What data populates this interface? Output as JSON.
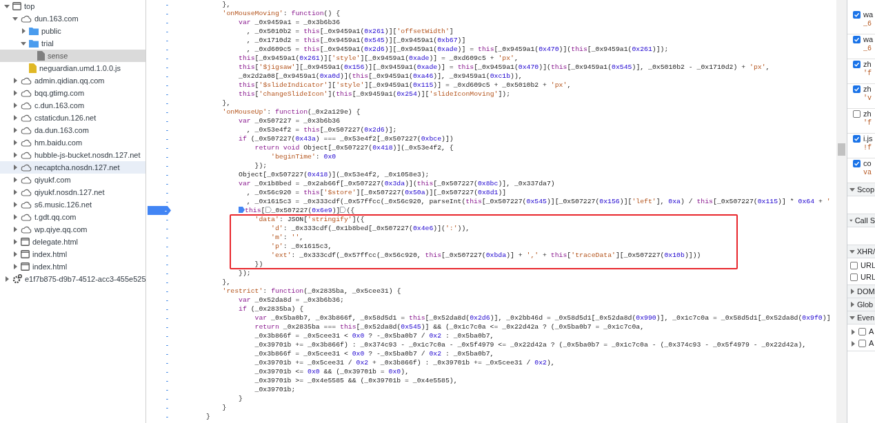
{
  "file_tree": [
    {
      "kind": "frame",
      "label": "top",
      "expanded": true,
      "selected": false,
      "hovered": false,
      "children": [
        {
          "kind": "domain",
          "label": "dun.163.com",
          "expanded": true,
          "selected": false,
          "hovered": false,
          "children": [
            {
              "kind": "folder",
              "label": "public",
              "expanded": false,
              "selected": false,
              "hovered": false
            },
            {
              "kind": "folder",
              "label": "trial",
              "expanded": true,
              "selected": false,
              "hovered": false,
              "children": [
                {
                  "kind": "file",
                  "label": "sense",
                  "selected": true,
                  "hovered": false
                }
              ]
            },
            {
              "kind": "script",
              "label": "neguardian.umd.1.0.0.js",
              "selected": false,
              "hovered": false
            }
          ]
        },
        {
          "kind": "domain",
          "label": "admin.qidian.qq.com",
          "expanded": false,
          "selected": false,
          "hovered": false
        },
        {
          "kind": "domain",
          "label": "bqq.gtimg.com",
          "expanded": false,
          "selected": false,
          "hovered": false
        },
        {
          "kind": "domain",
          "label": "c.dun.163.com",
          "expanded": false,
          "selected": false,
          "hovered": false
        },
        {
          "kind": "domain",
          "label": "cstaticdun.126.net",
          "expanded": false,
          "selected": false,
          "hovered": false
        },
        {
          "kind": "domain",
          "label": "da.dun.163.com",
          "expanded": false,
          "selected": false,
          "hovered": false
        },
        {
          "kind": "domain",
          "label": "hm.baidu.com",
          "expanded": false,
          "selected": false,
          "hovered": false
        },
        {
          "kind": "domain",
          "label": "hubble-js-bucket.nosdn.127.net",
          "expanded": false,
          "selected": false,
          "hovered": false
        },
        {
          "kind": "domain",
          "label": "necaptcha.nosdn.127.net",
          "expanded": false,
          "selected": false,
          "hovered": true
        },
        {
          "kind": "domain",
          "label": "qiyukf.com",
          "expanded": false,
          "selected": false,
          "hovered": false
        },
        {
          "kind": "domain",
          "label": "qiyukf.nosdn.127.net",
          "expanded": false,
          "selected": false,
          "hovered": false
        },
        {
          "kind": "domain",
          "label": "s6.music.126.net",
          "expanded": false,
          "selected": false,
          "hovered": false
        },
        {
          "kind": "domain",
          "label": "t.gdt.qq.com",
          "expanded": false,
          "selected": false,
          "hovered": false
        },
        {
          "kind": "domain",
          "label": "wp.qiye.qq.com",
          "expanded": false,
          "selected": false,
          "hovered": false
        },
        {
          "kind": "frame",
          "label": "delegate.html",
          "expanded": false,
          "selected": false,
          "hovered": false
        },
        {
          "kind": "frame",
          "label": "index.html",
          "expanded": false,
          "selected": false,
          "hovered": false
        },
        {
          "kind": "frame",
          "label": "index.html",
          "expanded": false,
          "selected": false,
          "hovered": false
        }
      ]
    },
    {
      "kind": "worker",
      "label": "e1f7b875-d9b7-4512-acc3-455e525",
      "expanded": false,
      "selected": false,
      "hovered": false
    }
  ],
  "editor": {
    "lines": [
      {
        "marker": "-",
        "breakpoint": false,
        "boxed": false,
        "text": "            },"
      },
      {
        "marker": "-",
        "breakpoint": false,
        "boxed": false,
        "text": "            'onMouseMoving': function() {"
      },
      {
        "marker": "-",
        "breakpoint": false,
        "boxed": false,
        "text": "                var _0x9459a1 = _0x3b6b36"
      },
      {
        "marker": "-",
        "breakpoint": false,
        "boxed": false,
        "text": "                  , _0x5010b2 = this[_0x9459a1(0x261)]['offsetWidth']"
      },
      {
        "marker": "-",
        "breakpoint": false,
        "boxed": false,
        "text": "                  , _0x1710d2 = this[_0x9459a1(0x545)][_0x9459a1(0xb67)]"
      },
      {
        "marker": "-",
        "breakpoint": false,
        "boxed": false,
        "text": "                  , _0xd609c5 = this[_0x9459a1(0x2d6)][_0x9459a1(0xade)] = this[_0x9459a1(0x470)](this[_0x9459a1(0x261)]);"
      },
      {
        "marker": "-",
        "breakpoint": false,
        "boxed": false,
        "text": "                this[_0x9459a1(0x261)]['style'][_0x9459a1(0xade)] = _0xd609c5 + 'px',"
      },
      {
        "marker": "-",
        "breakpoint": false,
        "boxed": false,
        "text": "                this['$jigsaw'][_0x9459a1(0x156)][_0x9459a1(0xade)] = this[_0x9459a1(0x470)](this[_0x9459a1(0x545)], _0x5010b2 - _0x1710d2) + 'px',"
      },
      {
        "marker": "-",
        "breakpoint": false,
        "boxed": false,
        "text": "                _0x2d2a08[_0x9459a1(0xa0d)](this[_0x9459a1(0xa46)], _0x9459a1(0xc1b)),"
      },
      {
        "marker": "-",
        "breakpoint": false,
        "boxed": false,
        "text": "                this['$slideIndicator']['style'][_0x9459a1(0x115)] = _0xd609c5 + _0x5010b2 + 'px',"
      },
      {
        "marker": "-",
        "breakpoint": false,
        "boxed": false,
        "text": "                this['changeSlideIcon'](this[_0x9459a1(0x254)]['slideIconMoving']);"
      },
      {
        "marker": "-",
        "breakpoint": false,
        "boxed": false,
        "text": "            },"
      },
      {
        "marker": "-",
        "breakpoint": false,
        "boxed": false,
        "text": "            'onMouseUp': function(_0x2a129e) {"
      },
      {
        "marker": "-",
        "breakpoint": false,
        "boxed": false,
        "text": "                var _0x507227 = _0x3b6b36"
      },
      {
        "marker": "-",
        "breakpoint": false,
        "boxed": false,
        "text": "                  , _0x53e4f2 = this[_0x507227(0x2d6)];"
      },
      {
        "marker": "-",
        "breakpoint": false,
        "boxed": false,
        "text": "                if (_0x507227(0x43a) === _0x53e4f2[_0x507227(0xbce)])"
      },
      {
        "marker": "-",
        "breakpoint": false,
        "boxed": false,
        "text": "                    return void Object[_0x507227(0x418)](_0x53e4f2, {"
      },
      {
        "marker": "-",
        "breakpoint": false,
        "boxed": false,
        "text": "                        'beginTime': 0x0"
      },
      {
        "marker": "-",
        "breakpoint": false,
        "boxed": false,
        "text": "                    });"
      },
      {
        "marker": "-",
        "breakpoint": false,
        "boxed": false,
        "text": "                Object[_0x507227(0x418)](_0x53e4f2, _0x1058e3);"
      },
      {
        "marker": "-",
        "breakpoint": false,
        "boxed": false,
        "text": "                var _0x1b8bed = _0x2ab66f[_0x507227(0x3da)](this[_0x507227(0x8bc)], _0x337da7)"
      },
      {
        "marker": "-",
        "breakpoint": false,
        "boxed": false,
        "text": "                  , _0x56c920 = this['$store'][_0x507227(0x50a)][_0x507227(0x8d1)]"
      },
      {
        "marker": "-",
        "breakpoint": false,
        "boxed": false,
        "text": "                  , _0x1615c3 = _0x333cdf(_0x57ffcc(_0x56c920, parseInt(this[_0x507227(0x545)][_0x507227(0x156)]['left'], 0xa) / this[_0x507227(0x115)] * 0x64 + '"
      },
      {
        "marker": "-",
        "breakpoint": true,
        "boxed": false,
        "parts": [
          "                this[",
          "_0x507227(0x6e9)]",
          "({"
        ]
      },
      {
        "marker": "-",
        "breakpoint": false,
        "boxed": true,
        "text": "                    'data': JSON['stringify']({"
      },
      {
        "marker": "-",
        "breakpoint": false,
        "boxed": true,
        "text": "                        'd': _0x333cdf(_0x1b8bed[_0x507227(0x4e6)](':')),"
      },
      {
        "marker": "-",
        "breakpoint": false,
        "boxed": true,
        "text": "                        'm': '',"
      },
      {
        "marker": "-",
        "breakpoint": false,
        "boxed": true,
        "text": "                        'p': _0x1615c3,"
      },
      {
        "marker": "-",
        "breakpoint": false,
        "boxed": true,
        "text": "                        'ext': _0x333cdf(_0x57ffcc(_0x56c920, this[_0x507227(0xbda)] + ',' + this['traceData'][_0x507227(0x10b)]))"
      },
      {
        "marker": "-",
        "breakpoint": false,
        "boxed": true,
        "text": "                    })"
      },
      {
        "marker": "-",
        "breakpoint": false,
        "boxed": false,
        "text": "                });"
      },
      {
        "marker": "-",
        "breakpoint": false,
        "boxed": false,
        "text": "            },"
      },
      {
        "marker": "-",
        "breakpoint": false,
        "boxed": false,
        "text": "            'restrict': function(_0x2835ba, _0x5cee31) {"
      },
      {
        "marker": "-",
        "breakpoint": false,
        "boxed": false,
        "text": "                var _0x52da8d = _0x3b6b36;"
      },
      {
        "marker": "-",
        "breakpoint": false,
        "boxed": false,
        "text": "                if (_0x2835ba) {"
      },
      {
        "marker": "-",
        "breakpoint": false,
        "boxed": false,
        "text": "                    var _0x5ba0b7, _0x3b866f, _0x58d5d1 = this[_0x52da8d(0x2d6)], _0x2bb46d = _0x58d5d1[_0x52da8d(0x990)], _0x1c7c0a = _0x58d5d1[_0x52da8d(0x9f0)]"
      },
      {
        "marker": "-",
        "breakpoint": false,
        "boxed": false,
        "text": "                    return _0x2835ba === this[_0x52da8d(0x545)] && (_0x1c7c0a <= _0x22d42a ? (_0x5ba0b7 = _0x1c7c0a,"
      },
      {
        "marker": "-",
        "breakpoint": false,
        "boxed": false,
        "text": "                    _0x3b866f = _0x5cee31 < 0x0 ? -_0x5ba0b7 / 0x2 : _0x5ba0b7,"
      },
      {
        "marker": "-",
        "breakpoint": false,
        "boxed": false,
        "text": "                    _0x39701b += _0x3b866f) : _0x374c93 - _0x1c7c0a - _0x5f4979 <= _0x22d42a ? (_0x5ba0b7 = _0x1c7c0a - (_0x374c93 - _0x5f4979 - _0x22d42a),"
      },
      {
        "marker": "-",
        "breakpoint": false,
        "boxed": false,
        "text": "                    _0x3b866f = _0x5cee31 < 0x0 ? -_0x5ba0b7 / 0x2 : _0x5ba0b7,"
      },
      {
        "marker": "-",
        "breakpoint": false,
        "boxed": false,
        "text": "                    _0x39701b += _0x5cee31 / 0x2 + _0x3b866f) : _0x39701b += _0x5cee31 / 0x2),"
      },
      {
        "marker": "-",
        "breakpoint": false,
        "boxed": false,
        "text": "                    _0x39701b <= 0x0 && (_0x39701b = 0x0),"
      },
      {
        "marker": "-",
        "breakpoint": false,
        "boxed": false,
        "text": "                    _0x39701b >= _0x4e5585 && (_0x39701b = _0x4e5585),"
      },
      {
        "marker": "-",
        "breakpoint": false,
        "boxed": false,
        "text": "                    _0x39701b;"
      },
      {
        "marker": "-",
        "breakpoint": false,
        "boxed": false,
        "text": "                }"
      },
      {
        "marker": "-",
        "breakpoint": false,
        "boxed": false,
        "text": "            }"
      },
      {
        "marker": "-",
        "breakpoint": false,
        "boxed": false,
        "text": "        }"
      }
    ]
  },
  "debugger_panel": {
    "breakpoints": [
      {
        "checked": true,
        "title": "wa",
        "detail": "_6"
      },
      {
        "checked": true,
        "title": "wa",
        "detail": "_6"
      },
      {
        "checked": true,
        "title": "zh",
        "detail": "'f"
      },
      {
        "checked": true,
        "title": "zh",
        "detail": "'v"
      },
      {
        "checked": false,
        "title": "zh",
        "detail": "'f"
      },
      {
        "checked": true,
        "title": "i.js",
        "detail": "!f"
      },
      {
        "checked": true,
        "title": "co",
        "detail": "va"
      }
    ],
    "sections": [
      {
        "title": "Scop",
        "expanded": true
      },
      {
        "title": "Call S",
        "expanded": true
      },
      {
        "title": "XHR/",
        "expanded": true,
        "items": [
          {
            "label": "URL",
            "checked": false
          },
          {
            "label": "URL",
            "checked": false
          }
        ]
      },
      {
        "title": "DOM",
        "expanded": false
      },
      {
        "title": "Glob",
        "expanded": false
      },
      {
        "title": "Even",
        "expanded": true,
        "items": [
          {
            "label": "A",
            "checked": false,
            "expanded": false
          },
          {
            "label": "A",
            "checked": false,
            "expanded": false
          }
        ]
      }
    ]
  }
}
